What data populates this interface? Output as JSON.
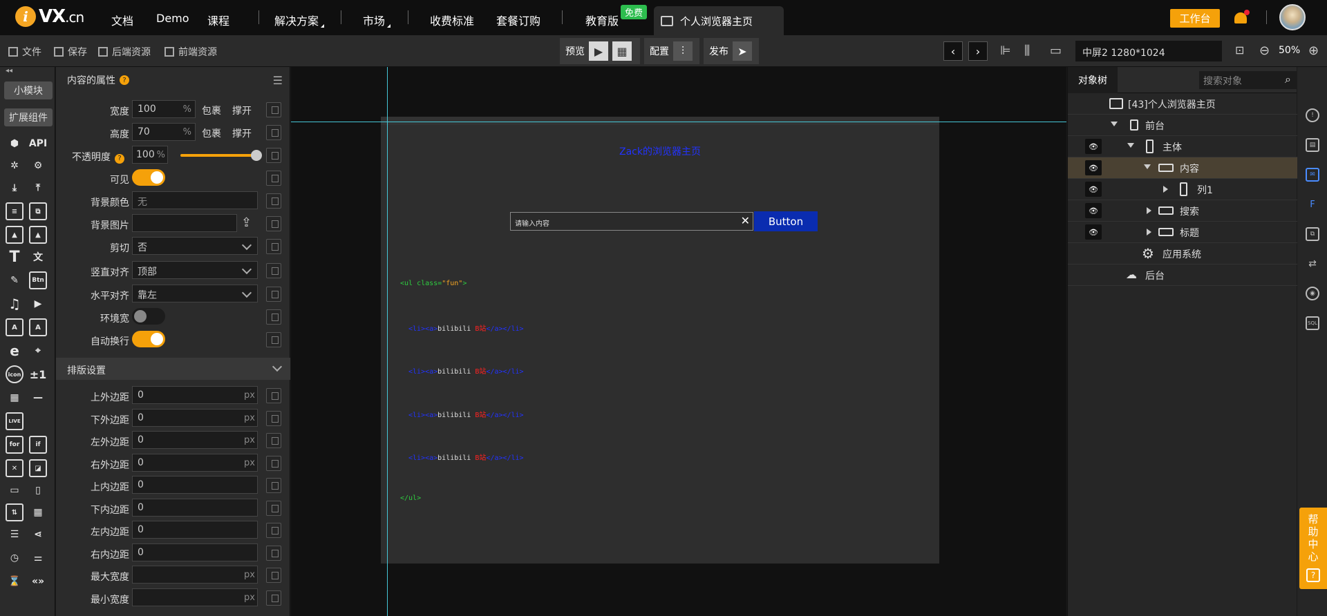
{
  "header": {
    "logo_text": "VX",
    "logo_suffix": ".cn",
    "nav": [
      "文档",
      "Demo",
      "课程",
      "解决方案",
      "市场",
      "收费标准",
      "套餐订购",
      "教育版"
    ],
    "badge": "免费",
    "page_tab": "个人浏览器主页",
    "workbench": "工作台"
  },
  "toolbar": {
    "file": "文件",
    "save": "保存",
    "backend": "后端资源",
    "frontend": "前端资源",
    "preview": "预览",
    "config": "配置",
    "publish": "发布",
    "screen": "中屏2 1280*1024",
    "zoom": "50%"
  },
  "rail": {
    "small_module": "小模块",
    "extend": "扩展组件",
    "labels": [
      "API",
      "Btn",
      "icon",
      "±1",
      "LIVE",
      "for",
      "if"
    ]
  },
  "props": {
    "title": "内容的属性",
    "width_label": "宽度",
    "width": "100",
    "width_unit": "%",
    "wrap": "包裹",
    "stretch": "撑开",
    "height_label": "高度",
    "height": "70",
    "height_unit": "%",
    "opacity_label": "不透明度",
    "opacity": "100",
    "opacity_unit": "%",
    "opacity_value": 1.0,
    "visible_label": "可见",
    "bgcolor_label": "背景颜色",
    "bgcolor": "无",
    "bgimage_label": "背景图片",
    "clip_label": "剪切",
    "clip": "否",
    "valign_label": "竖直对齐",
    "valign": "顶部",
    "halign_label": "水平对齐",
    "halign": "靠左",
    "envwidth_label": "环境宽",
    "autowrap_label": "自动换行",
    "layout_section": "排版设置",
    "margin_top_label": "上外边距",
    "margin_top": "0",
    "margin_bottom_label": "下外边距",
    "margin_bottom": "0",
    "margin_left_label": "左外边距",
    "margin_left": "0",
    "margin_right_label": "右外边距",
    "margin_right": "0",
    "padding_top_label": "上内边距",
    "padding_top": "0",
    "padding_bottom_label": "下内边距",
    "padding_bottom": "0",
    "padding_left_label": "左内边距",
    "padding_left": "0",
    "padding_right_label": "右内边距",
    "padding_right": "0",
    "max_width_label": "最大宽度",
    "min_width_label": "最小宽度",
    "px": "px"
  },
  "canvas": {
    "title": "Zack的浏览器主页",
    "search_placeholder": "请输入内容",
    "button": "Button",
    "code_open_tag": "<ul class=",
    "code_open_class": "\"fun\"",
    "code_open_close": ">",
    "code_li_a": "<li><a>",
    "code_li_text": "bilibili",
    "code_li_red": "B站",
    "code_li_end": "</a></li>",
    "code_close": "</ul>"
  },
  "tree": {
    "tab": "对象树",
    "search_placeholder": "搜索对象",
    "nodes": [
      "[43]个人浏览器主页",
      "前台",
      "主体",
      "内容",
      "列1",
      "搜索",
      "标题",
      "应用系统",
      "后台"
    ]
  },
  "help": "帮助中心"
}
